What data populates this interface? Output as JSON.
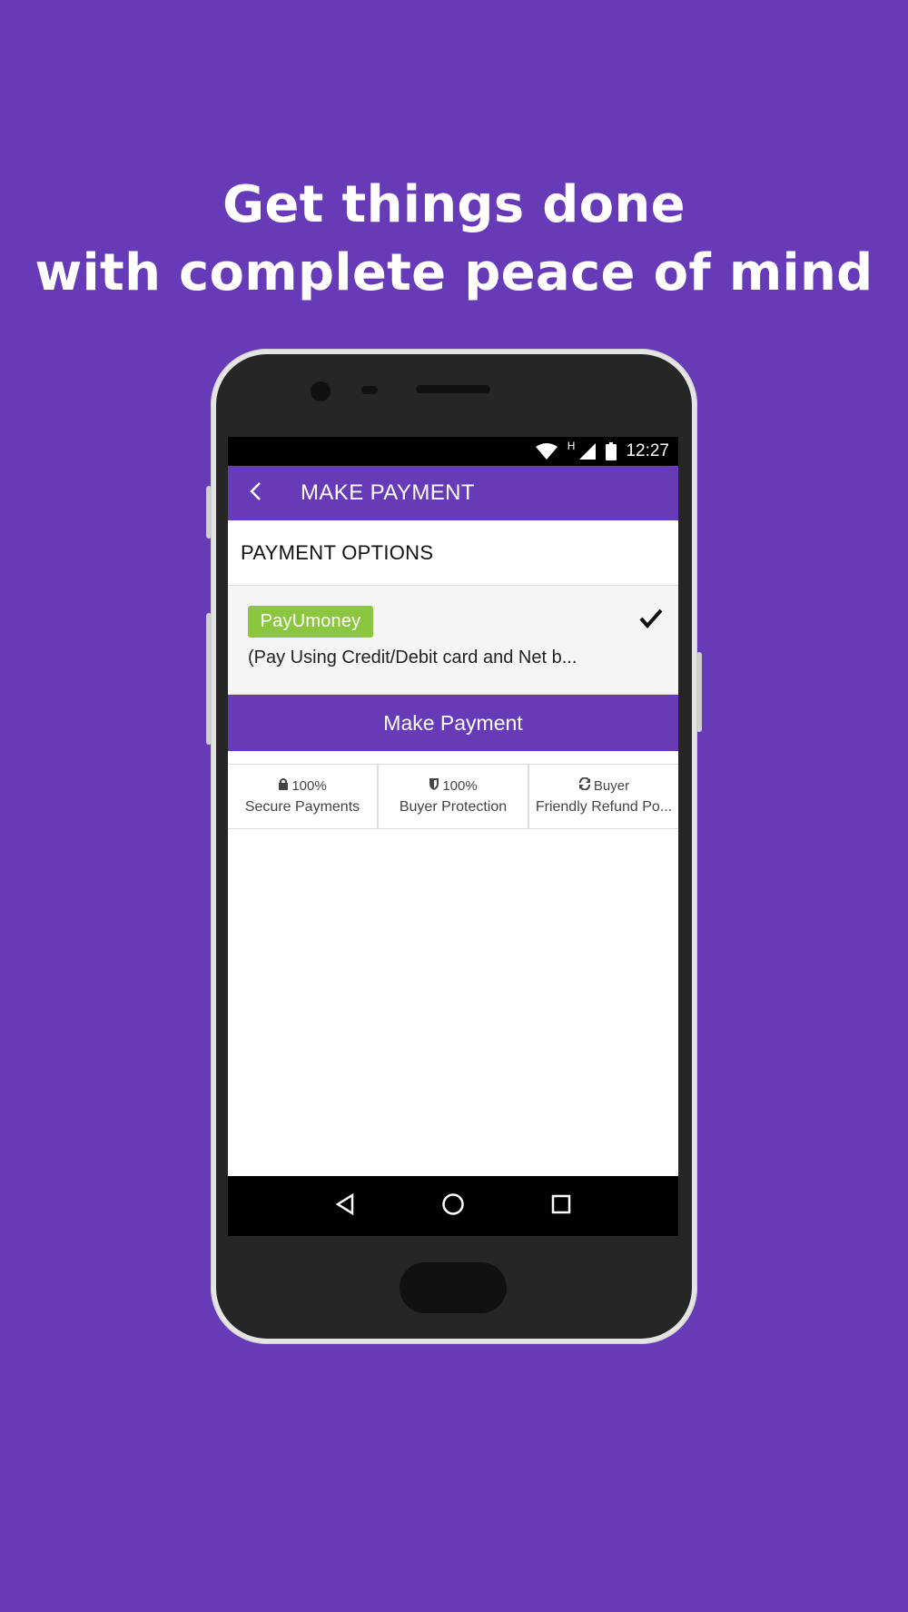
{
  "headline": {
    "line1": "Get things done",
    "line2": "with complete peace of mind"
  },
  "status_bar": {
    "network_label": "H",
    "time": "12:27",
    "icons": [
      "wifi-icon",
      "signal-icon",
      "battery-icon"
    ]
  },
  "app_bar": {
    "title": "MAKE PAYMENT",
    "back_icon": "chevron-left-icon"
  },
  "payment": {
    "section_title": "PAYMENT OPTIONS",
    "option": {
      "logo_text": "PayUmoney",
      "description": "(Pay Using Credit/Debit card and Net b...",
      "selected": true
    },
    "button_label": "Make Payment"
  },
  "badges": [
    {
      "icon": "lock-icon",
      "top": "100%",
      "bottom": "Secure Payments"
    },
    {
      "icon": "shield-icon",
      "top": "100%",
      "bottom": "Buyer Protection"
    },
    {
      "icon": "refresh-icon",
      "top": "Buyer",
      "bottom": "Friendly Refund Po..."
    }
  ],
  "nav_bar": [
    "back-triangle-icon",
    "home-circle-icon",
    "recents-square-icon"
  ],
  "colors": {
    "background": "#673ab7",
    "accent": "#673ab7",
    "payu_green": "#8cc63f"
  }
}
